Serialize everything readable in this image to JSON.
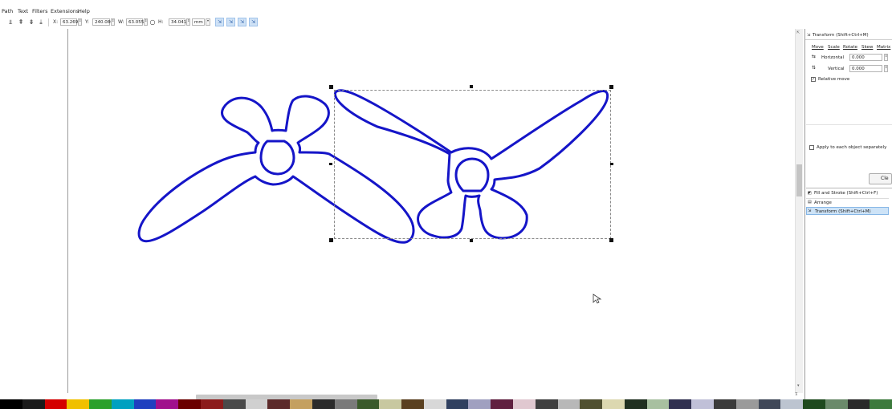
{
  "menu": {
    "items": [
      "Path",
      "Text",
      "Filters",
      "Extensions",
      "Help"
    ]
  },
  "toolbar": {
    "x_label": "X:",
    "x_value": "63.269",
    "y_label": "Y:",
    "y_value": "240.080",
    "w_label": "W:",
    "w_value": "63.055",
    "h_label": "H:",
    "h_value": "34.041",
    "unit": "mm"
  },
  "dock": {
    "transform_title": "Transform (Shift+Ctrl+M)",
    "tabs": [
      "Move",
      "Scale",
      "Rotate",
      "Skew",
      "Matrix"
    ],
    "horizontal_label": "Horizontal",
    "horizontal_value": "0.000",
    "vertical_label": "Vertical",
    "vertical_value": "0.000",
    "relative_move": "Relative move",
    "apply_each": "Apply to each object separately",
    "clear_btn": "Cle",
    "panels": [
      "Fill and Stroke (Shift+Ctrl+F)",
      "Arrange",
      "Transform (Shift+Ctrl+M)"
    ]
  },
  "colors": {
    "shape_stroke": "#1515c8",
    "selected_panel": "#cde3f7"
  },
  "icons": {
    "cursor": "arrow-cursor-icon"
  }
}
